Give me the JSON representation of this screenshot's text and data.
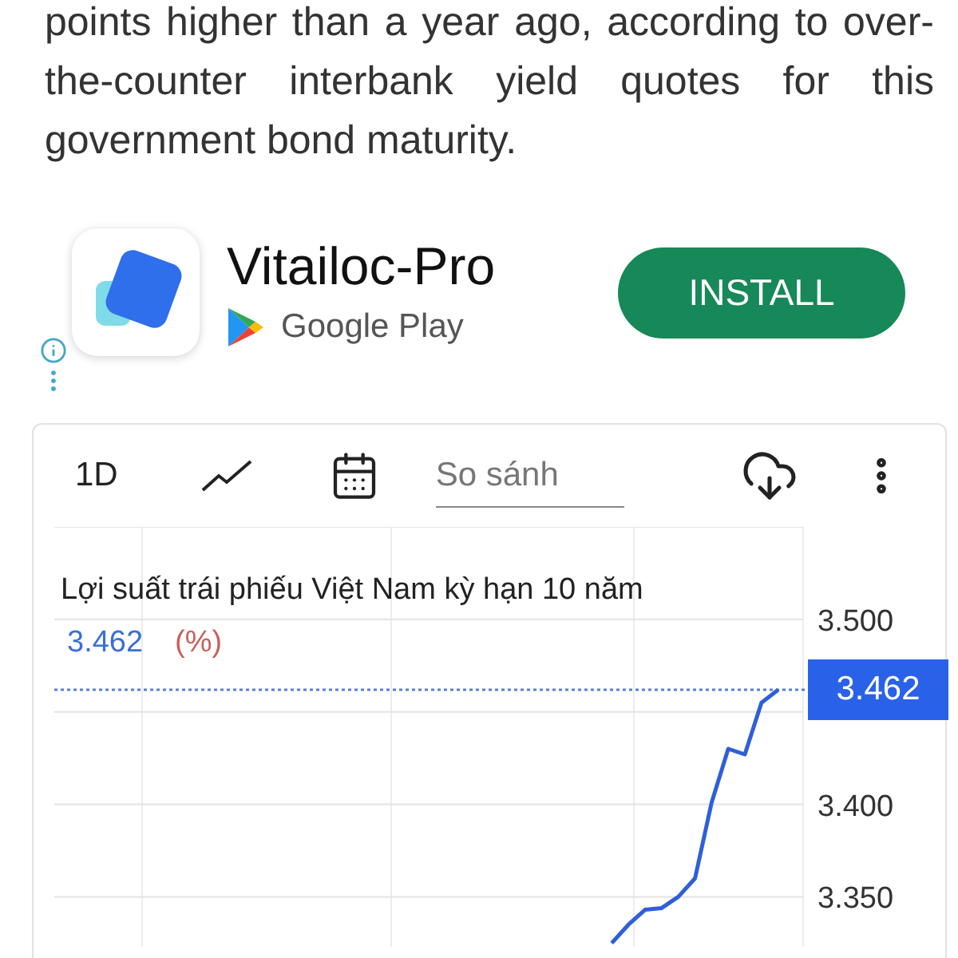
{
  "article": {
    "paragraph": "points higher than a year ago, according to over-the-counter interbank yield quotes for this government bond maturity."
  },
  "ad": {
    "app_name": "Vitailoc-Pro",
    "store": "Google Play",
    "button": "INSTALL"
  },
  "chart_widget": {
    "toolbar": {
      "range": "1D",
      "compare": {
        "placeholder": "So sánh"
      }
    },
    "title": "Lợi suất trái phiếu Việt Nam kỳ hạn 10 năm",
    "reading": "3.462",
    "unit": "(%)",
    "chart_data": {
      "type": "line",
      "ylim": [
        3.323,
        3.55
      ],
      "grid": true,
      "ref_lines": [
        {
          "axis": "y",
          "value": 3.462,
          "label": "3.462",
          "color": "#5b7fd6"
        }
      ],
      "yticks": [
        {
          "value": 3.35,
          "label": "3.350"
        },
        {
          "value": 3.4,
          "label": "3.400"
        },
        {
          "value": 3.5,
          "label": "3.500"
        }
      ],
      "categories": [
        null,
        null,
        null,
        null,
        null,
        null,
        null,
        null,
        null,
        null,
        null,
        null,
        null,
        null,
        null,
        null,
        null,
        null,
        null,
        null,
        null,
        null,
        null,
        null,
        null,
        null,
        null,
        null,
        null,
        null,
        null,
        null,
        null,
        null,
        null,
        null,
        null,
        null,
        null,
        null,
        null,
        null,
        null,
        null,
        null
      ],
      "series": [
        {
          "color": "#2f5fd8",
          "values": [
            null,
            null,
            null,
            null,
            null,
            null,
            null,
            null,
            null,
            null,
            null,
            null,
            null,
            null,
            null,
            null,
            null,
            null,
            null,
            null,
            null,
            null,
            null,
            null,
            null,
            null,
            null,
            null,
            null,
            null,
            null,
            null,
            null,
            3.325,
            3.335,
            3.343,
            3.344,
            3.35,
            3.36,
            3.401,
            3.43,
            3.427,
            3.455,
            3.462,
            null
          ]
        }
      ]
    }
  }
}
